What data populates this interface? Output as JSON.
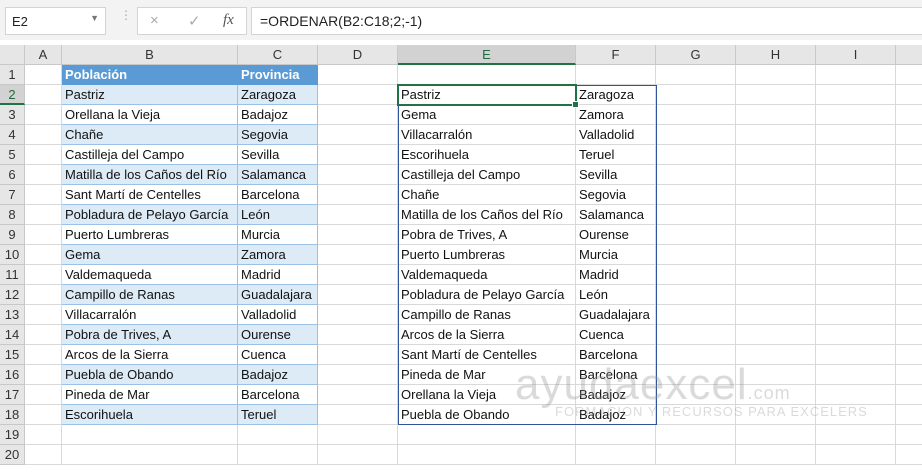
{
  "formula_bar": {
    "name_box": "E2",
    "cancel_icon": "×",
    "enter_icon": "✓",
    "fx_label": "fx",
    "formula": "=ORDENAR(B2:C18;2;-1)"
  },
  "columns": [
    "A",
    "B",
    "C",
    "D",
    "E",
    "F",
    "G",
    "H",
    "I"
  ],
  "rows": [
    "1",
    "2",
    "3",
    "4",
    "5",
    "6",
    "7",
    "8",
    "9",
    "10",
    "11",
    "12",
    "13",
    "14",
    "15",
    "16",
    "17",
    "18",
    "19",
    "20"
  ],
  "source_table": {
    "headers": [
      "Población",
      "Provincia"
    ],
    "rows": [
      [
        "Pastriz",
        "Zaragoza"
      ],
      [
        "Orellana la Vieja",
        "Badajoz"
      ],
      [
        "Chañe",
        "Segovia"
      ],
      [
        "Castilleja del Campo",
        "Sevilla"
      ],
      [
        "Matilla de los Caños del Río",
        "Salamanca"
      ],
      [
        "Sant Martí de Centelles",
        "Barcelona"
      ],
      [
        "Pobladura de Pelayo García",
        "León"
      ],
      [
        "Puerto Lumbreras",
        "Murcia"
      ],
      [
        "Gema",
        "Zamora"
      ],
      [
        "Valdemaqueda",
        "Madrid"
      ],
      [
        "Campillo de Ranas",
        "Guadalajara"
      ],
      [
        "Villacarralón",
        "Valladolid"
      ],
      [
        "Pobra de Trives, A",
        "Ourense"
      ],
      [
        "Arcos de la Sierra",
        "Cuenca"
      ],
      [
        "Puebla de Obando",
        "Badajoz"
      ],
      [
        "Pineda de Mar",
        "Barcelona"
      ],
      [
        "Escorihuela",
        "Teruel"
      ]
    ]
  },
  "sorted_result": [
    [
      "Pastriz",
      "Zaragoza"
    ],
    [
      "Gema",
      "Zamora"
    ],
    [
      "Villacarralón",
      "Valladolid"
    ],
    [
      "Escorihuela",
      "Teruel"
    ],
    [
      "Castilleja del Campo",
      "Sevilla"
    ],
    [
      "Chañe",
      "Segovia"
    ],
    [
      "Matilla de los Caños del Río",
      "Salamanca"
    ],
    [
      "Pobra de Trives, A",
      "Ourense"
    ],
    [
      "Puerto Lumbreras",
      "Murcia"
    ],
    [
      "Valdemaqueda",
      "Madrid"
    ],
    [
      "Pobladura de Pelayo García",
      "León"
    ],
    [
      "Campillo de Ranas",
      "Guadalajara"
    ],
    [
      "Arcos de la Sierra",
      "Cuenca"
    ],
    [
      "Sant Martí de Centelles",
      "Barcelona"
    ],
    [
      "Pineda de Mar",
      "Barcelona"
    ],
    [
      "Orellana la Vieja",
      "Badajoz"
    ],
    [
      "Puebla de Obando",
      "Badajoz"
    ]
  ],
  "watermark": {
    "logo": "ayudaexcel.com",
    "tagline": "FORMACION Y RECURSOS PARA EXCELERS"
  },
  "colors": {
    "header_fill": "#5b9bd5",
    "band_fill": "#ddebf7",
    "selection": "#217346",
    "spill_border": "#2f5597"
  }
}
